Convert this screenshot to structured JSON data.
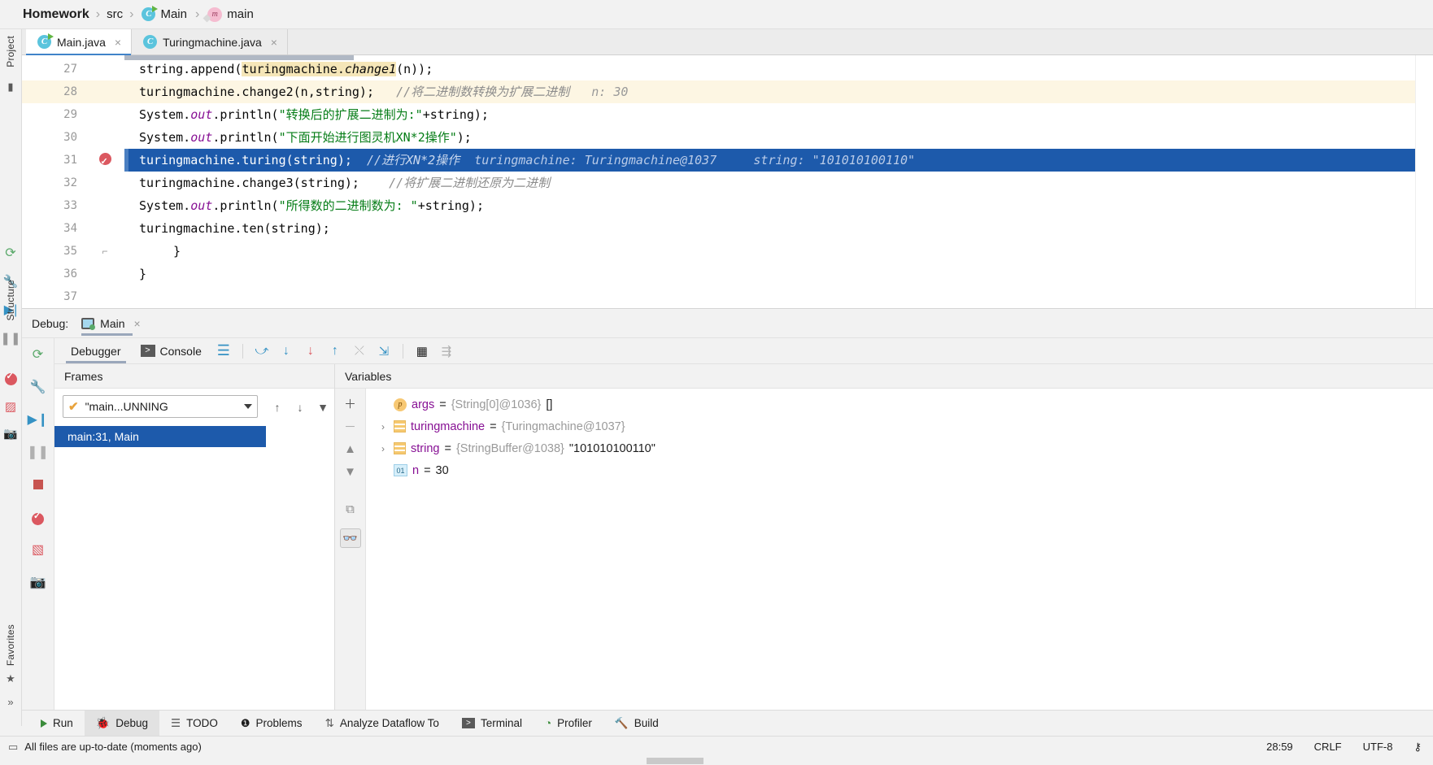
{
  "breadcrumb": {
    "root": "Homework",
    "items": [
      {
        "label": "src",
        "icon": ""
      },
      {
        "label": "Main",
        "icon": "class-icon"
      },
      {
        "label": "main",
        "icon": "method-icon"
      }
    ],
    "separator": "›"
  },
  "editor_tabs": [
    {
      "label": "Main.java",
      "icon": "class-icon",
      "active": true,
      "close": "×"
    },
    {
      "label": "Turingmachine.java",
      "icon": "class-icon-plain",
      "active": false,
      "close": "×"
    }
  ],
  "left_strip": {
    "project_label": "Project",
    "structure_label": "Structure",
    "favorites_label": "Favorites",
    "more": "»"
  },
  "editor": {
    "line_numbers": [
      "27",
      "28",
      "29",
      "30",
      "31",
      "32",
      "33",
      "34",
      "35",
      "36",
      "37"
    ],
    "lines": [
      {
        "num": "27",
        "code_pre": "string.append(",
        "ident": "turingmachine.",
        "method": "change1",
        "code_post": "(n));",
        "state": "normal"
      },
      {
        "num": "28",
        "text": "turingmachine.change2(n,string);",
        "comment": "//将二进制数转换为扩展二进制",
        "hint": "n: 30",
        "state": "soft"
      },
      {
        "num": "29",
        "prefix": "System.",
        "field": "out",
        "mid": ".println(",
        "string": "\"转换后的扩展二进制为:\"",
        "suffix": "+string);",
        "state": "normal"
      },
      {
        "num": "30",
        "prefix": "System.",
        "field": "out",
        "mid": ".println(",
        "string": "\"下面开始进行图灵机XN*2操作\"",
        "suffix": ");",
        "state": "normal"
      },
      {
        "num": "31",
        "text": "turingmachine.turing(string);",
        "comment": "//进行XN*2操作",
        "hint": "turingmachine: Turingmachine@1037     string: \"101010100110\"",
        "state": "executing",
        "breakpoint": true
      },
      {
        "num": "32",
        "text": "turingmachine.change3(string);",
        "comment": "//将扩展二进制还原为二进制",
        "state": "normal"
      },
      {
        "num": "33",
        "prefix": "System.",
        "field": "out",
        "mid": ".println(",
        "string": "\"所得数的二进制数为: \"",
        "suffix": "+string);",
        "state": "normal"
      },
      {
        "num": "34",
        "text": "turingmachine.ten(string);",
        "state": "normal"
      },
      {
        "num": "35",
        "text": "}",
        "state": "normal",
        "fold": true
      },
      {
        "num": "36",
        "text": "}",
        "state": "normal"
      },
      {
        "num": "37",
        "text": "",
        "state": "normal"
      }
    ]
  },
  "debug": {
    "header_label": "Debug:",
    "session_tab": "Main",
    "session_close": "×",
    "tabs": [
      {
        "label": "Debugger",
        "icon": "debugger-icon",
        "active": true
      },
      {
        "label": "Console",
        "icon": "console-icon",
        "active": false
      }
    ],
    "frames_header": "Frames",
    "variables_header": "Variables",
    "thread_selector": "\"main...UNNING",
    "frames": [
      {
        "label": "main:31, Main",
        "selected": true
      }
    ],
    "variables": [
      {
        "twisty": "",
        "icon": "param-icon",
        "icon_char": "p",
        "name": "args",
        "eq": "=",
        "type": "{String[0]@1036}",
        "value": "[]"
      },
      {
        "twisty": "›",
        "icon": "object-icon",
        "name": "turingmachine",
        "eq": "=",
        "type": "{Turingmachine@1037}",
        "value": ""
      },
      {
        "twisty": "›",
        "icon": "object-icon",
        "name": "string",
        "eq": "=",
        "type": "{StringBuffer@1038}",
        "value": "\"101010100110\""
      },
      {
        "twisty": "",
        "icon": "primitive-icon",
        "icon_char": "01",
        "name": "n",
        "eq": "=",
        "type": "",
        "value": "30"
      }
    ]
  },
  "bottom_bar": [
    {
      "label": "Run",
      "icon": "play-icon",
      "active": false
    },
    {
      "label": "Debug",
      "icon": "bug-icon",
      "active": true
    },
    {
      "label": "TODO",
      "icon": "list-icon",
      "active": false
    },
    {
      "label": "Problems",
      "icon": "warning-icon",
      "active": false
    },
    {
      "label": "Analyze Dataflow To",
      "icon": "dataflow-icon",
      "active": false
    },
    {
      "label": "Terminal",
      "icon": "terminal-icon",
      "active": false
    },
    {
      "label": "Profiler",
      "icon": "profiler-icon",
      "active": false
    },
    {
      "label": "Build",
      "icon": "hammer-icon",
      "active": false
    }
  ],
  "status_bar": {
    "message": "All files are up-to-date (moments ago)",
    "position": "28:59",
    "line_sep": "CRLF",
    "encoding": "UTF-8",
    "lock": "⚷"
  },
  "colors": {
    "accent_blue": "#1d5aab",
    "tab_underline": "#4083c9",
    "string_green": "#067d17",
    "keyword_blue": "#0033b3",
    "field_purple": "#871094",
    "comment_gray": "#8c8c8c",
    "breakpoint_red": "#db5860",
    "soft_highlight": "#fdf6e3"
  }
}
